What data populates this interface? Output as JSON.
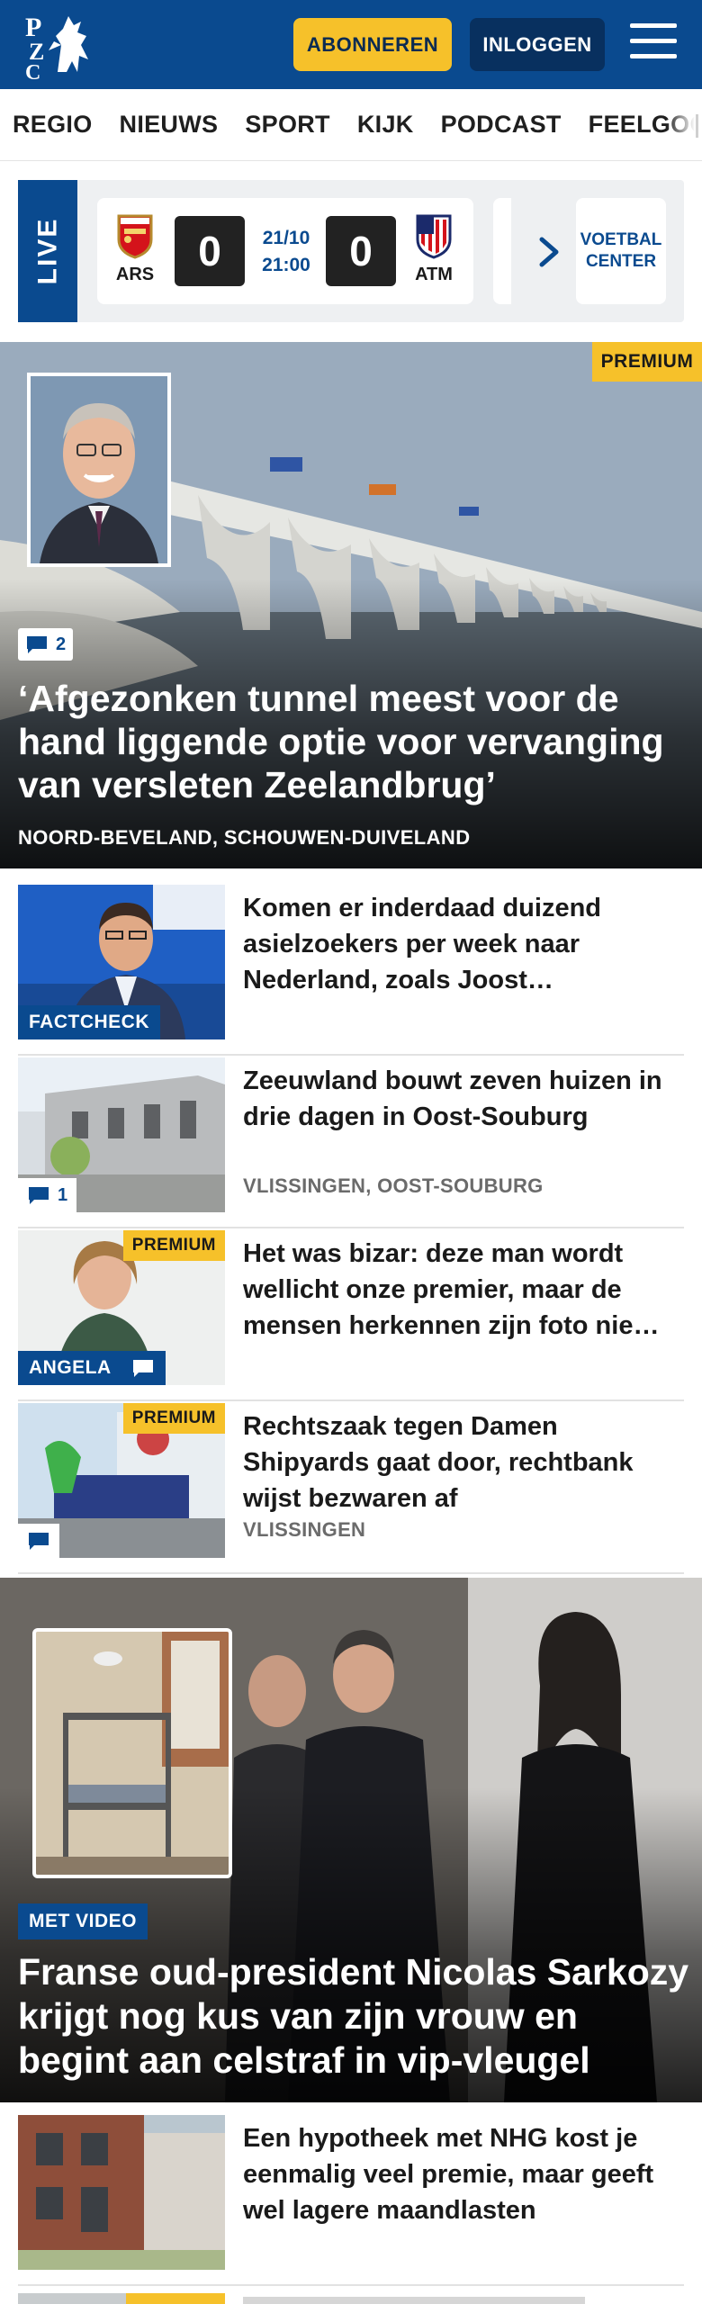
{
  "header": {
    "logo_text": "PZC",
    "subscribe_label": "ABONNEREN",
    "login_label": "INLOGGEN"
  },
  "nav": {
    "items": [
      "REGIO",
      "NIEUWS",
      "SPORT",
      "KIJK",
      "PODCAST",
      "FEELGOOD"
    ]
  },
  "live": {
    "label": "LIVE",
    "match": {
      "home_code": "ARS",
      "away_code": "ATM",
      "home_score": "0",
      "away_score": "0",
      "date": "21/10",
      "time": "21:00"
    },
    "voetbal_center": "VOETBAL CENTER"
  },
  "hero": {
    "premium": "PREMIUM",
    "comments": "2",
    "title": "‘Afgezonken tunnel meest voor de hand liggende optie voor vervanging van versleten Zeelandbrug’",
    "location": "NOORD-BEVELAND, SCHOUWEN-DUIVELAND"
  },
  "articles": [
    {
      "title": "Komen er inderdaad duizend asielzoekers per week naar Nederland, zoals Joost…",
      "label": "FACTCHECK"
    },
    {
      "title": "Zeeuwland bouwt zeven huizen in drie dagen in Oost-Souburg",
      "location": "VLISSINGEN, OOST-SOUBURG",
      "comments": "1"
    },
    {
      "title": "Het was bizar: deze man wordt wellicht onze premier, maar de mensen herkennen zijn foto nie…",
      "label": "ANGELA",
      "premium": "PREMIUM"
    },
    {
      "title": "Rechtszaak tegen Damen Shipyards gaat door, rechtbank wijst bezwaren af",
      "location": "VLISSINGEN",
      "premium": "PREMIUM"
    }
  ],
  "hero2": {
    "video_label": "MET VIDEO",
    "title": "Franse oud-president Nicolas Sarkozy krijgt nog kus van zijn vrouw en begint aan celstraf in vip-vleugel"
  },
  "last_article": {
    "title": "Een hypotheek met NHG kost je eenmalig veel premie, maar geeft wel lagere maandlasten"
  },
  "colors": {
    "brand_blue": "#0a4a8f",
    "accent_yellow": "#f6c12a",
    "dark_blue": "#08305f"
  }
}
